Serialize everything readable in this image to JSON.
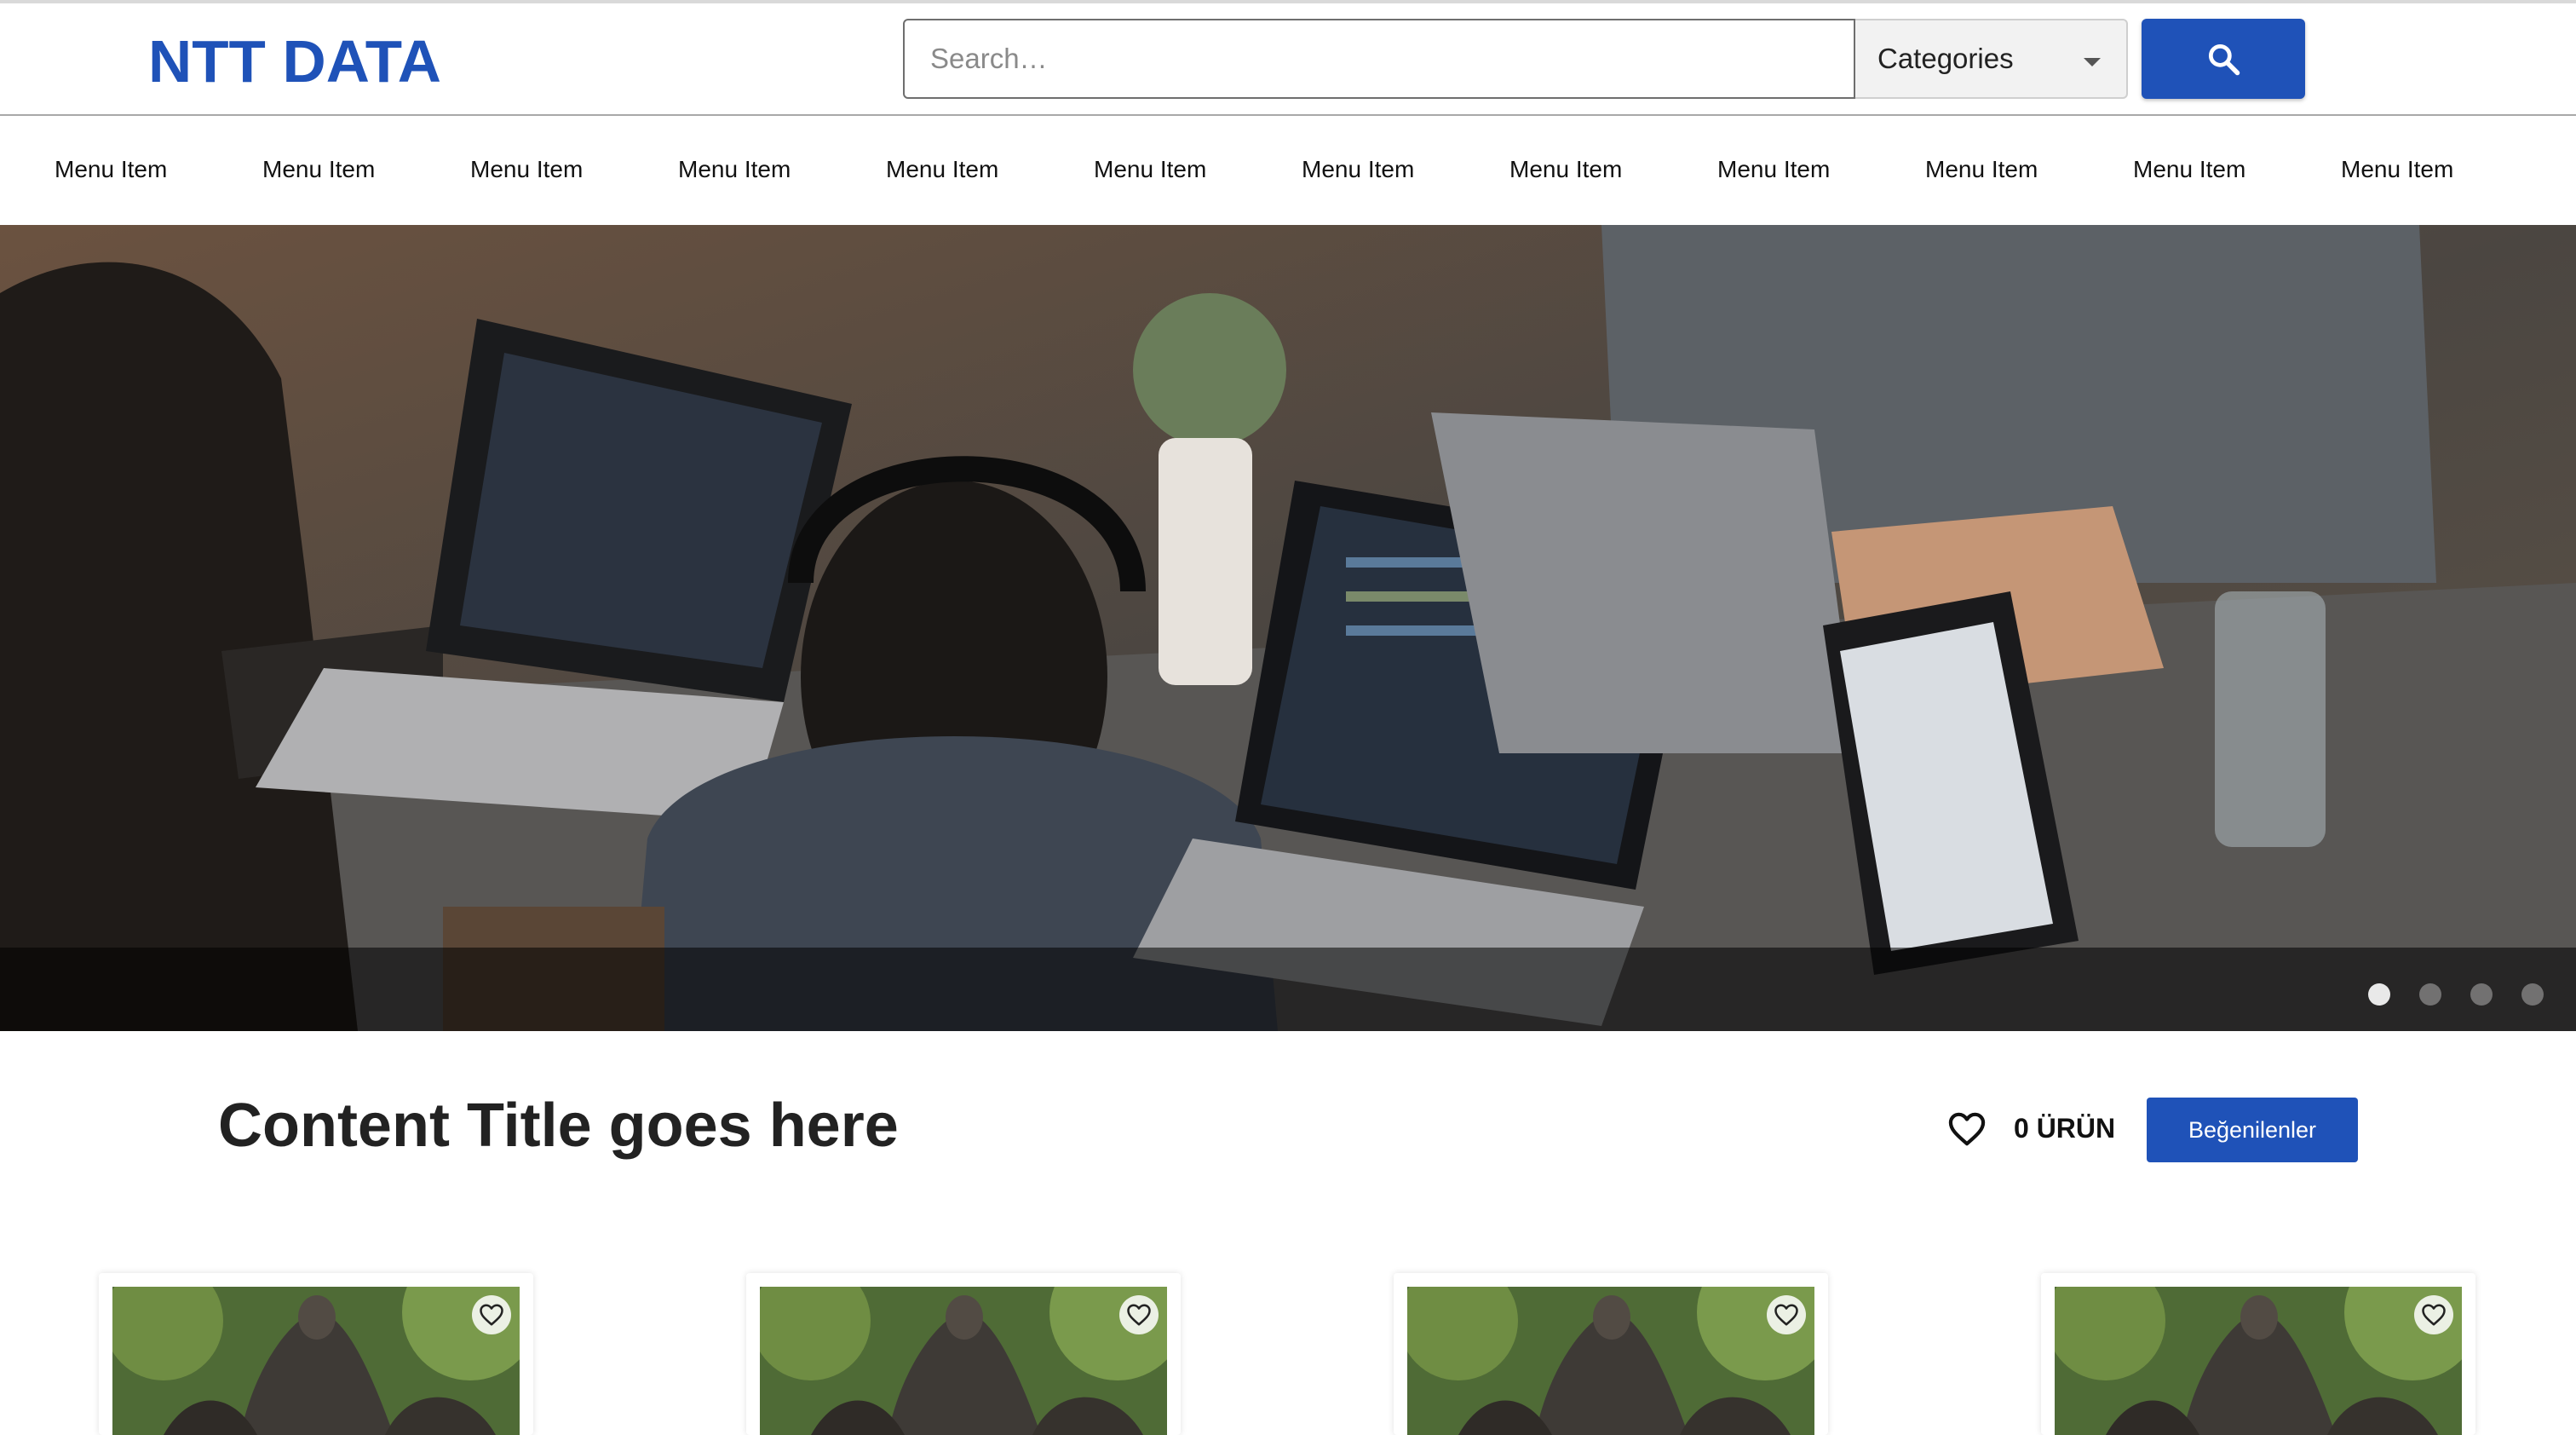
{
  "header": {
    "logo_text": "NTT DATA",
    "search_placeholder": "Search…",
    "categories_label": "Categories",
    "search_button_icon": "search-icon"
  },
  "nav": {
    "items": [
      "Menu Item",
      "Menu Item",
      "Menu Item",
      "Menu Item",
      "Menu Item",
      "Menu Item",
      "Menu Item",
      "Menu Item",
      "Menu Item",
      "Menu Item",
      "Menu Item",
      "Menu Item"
    ]
  },
  "hero": {
    "slide_count": 4,
    "active_slide": 1
  },
  "content": {
    "title": "Content Title goes here",
    "favorites_count_label": "0 ÜRÜN",
    "favorites_button_label": "Beğenilenler",
    "favorites_icon": "heart-icon"
  },
  "products": {
    "card_count": 4,
    "card_favorite_icon": "heart-icon"
  },
  "colors": {
    "brand_blue": "#1f52b8",
    "text_dark": "#222222"
  }
}
